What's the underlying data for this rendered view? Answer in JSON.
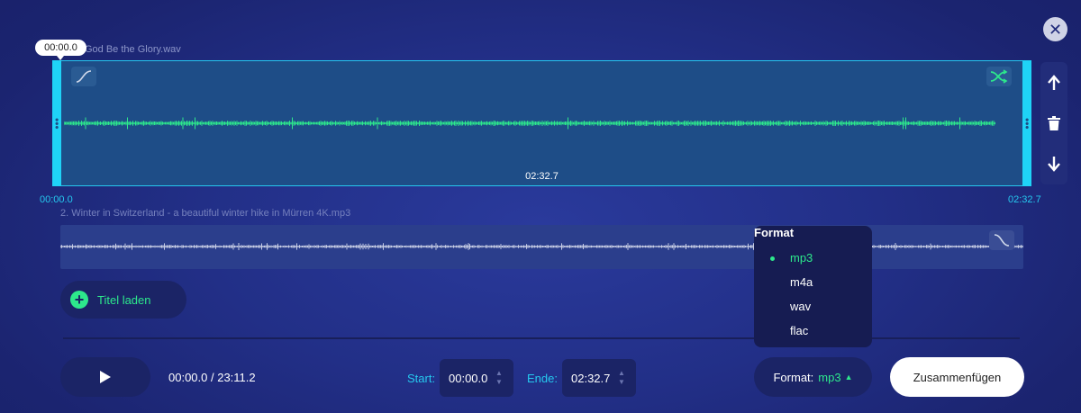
{
  "track1": {
    "label": "God Be the Glory.wav",
    "cursor_time": "00:00.0",
    "duration": "02:32.7",
    "range_start": "00:00.0",
    "range_end": "02:32.7"
  },
  "track2": {
    "label": "2. Winter in Switzerland - a beautiful winter hike in Mürren 4K.mp3"
  },
  "load_button": {
    "label": "Titel laden"
  },
  "player": {
    "timecode": "00:00.0 / 23:11.2",
    "start_label": "Start:",
    "start_value": "00:00.0",
    "end_label": "Ende:",
    "end_value": "02:32.7"
  },
  "format": {
    "button_label": "Format:",
    "selected": "mp3",
    "dropdown_title": "Format",
    "options": [
      "mp3",
      "m4a",
      "wav",
      "flac"
    ]
  },
  "merge_button": {
    "label": "Zusammenfügen"
  },
  "colors": {
    "accent_cyan": "#25c8ee",
    "accent_green": "#2de88c",
    "background": "#222f87"
  },
  "icons": {
    "close": "close-icon",
    "fade_in": "fade-in-icon",
    "shuffle": "shuffle-icon",
    "move_up": "arrow-up-icon",
    "delete": "trash-icon",
    "move_down": "arrow-down-icon",
    "fade_out": "fade-out-icon",
    "play": "play-icon",
    "add": "plus-icon"
  }
}
